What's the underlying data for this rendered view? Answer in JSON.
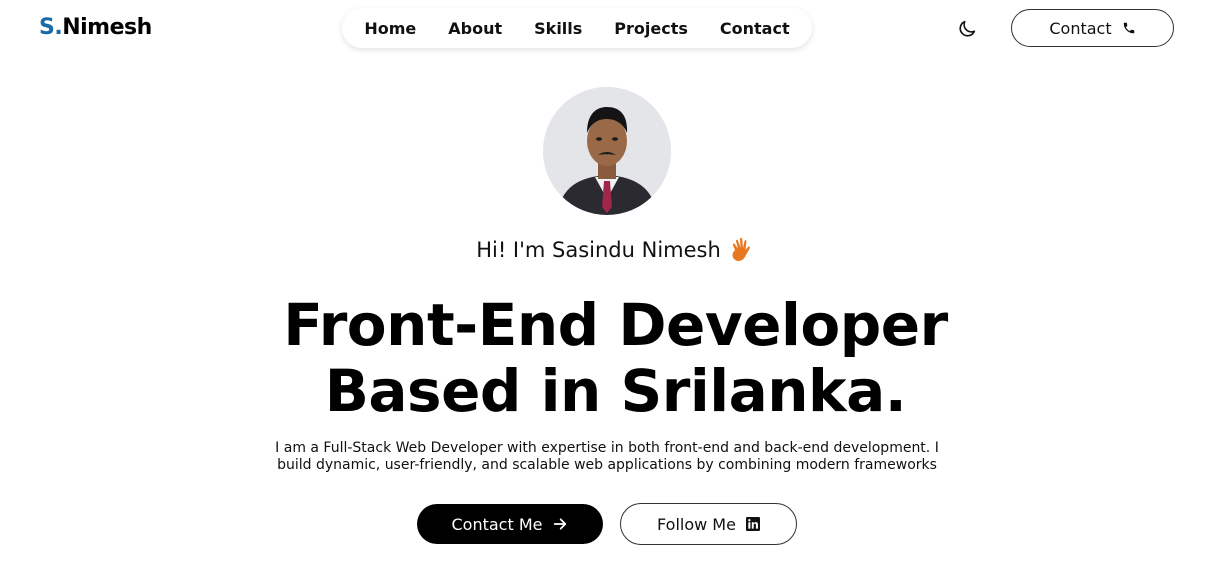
{
  "header": {
    "logo_prefix": "S.",
    "logo_name": "Nimesh",
    "nav": [
      "Home",
      "About",
      "Skills",
      "Projects",
      "Contact"
    ],
    "contact_label": "Contact",
    "theme_icon": "moon-icon",
    "contact_icon": "phone-icon"
  },
  "hero": {
    "greeting": "Hi! I'm Sasindu Nimesh",
    "greeting_icon": "waving-hand-icon",
    "headline_line1": "Front-End Developer",
    "headline_line2": "Based in Srilanka.",
    "description_line1": "I am a Full-Stack Web Developer with expertise in both front-end and back-end development. I",
    "description_line2": "build dynamic, user-friendly, and scalable web applications by combining modern frameworks",
    "primary_button": "Contact Me",
    "primary_icon": "arrow-right-icon",
    "secondary_button": "Follow Me",
    "secondary_icon": "linkedin-icon"
  },
  "colors": {
    "accent": "#1a6aa6",
    "primary_button_bg": "#000000",
    "wave": "#e8781f"
  }
}
